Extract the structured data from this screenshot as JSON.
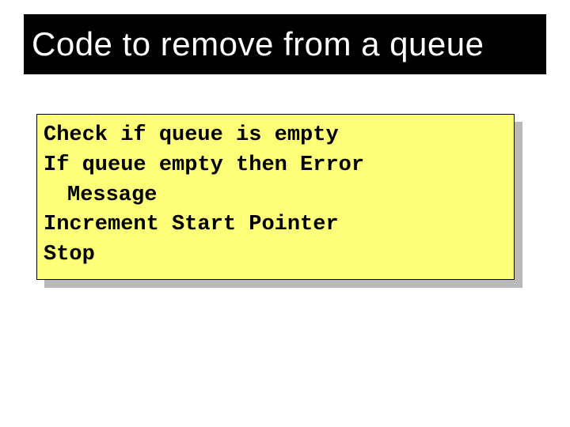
{
  "title": "Code to remove from a queue",
  "code": {
    "line1": "Check if queue is empty",
    "line2": "If queue empty then Error",
    "line3": "Message",
    "line4": "Increment Start Pointer",
    "line5": "Stop"
  }
}
